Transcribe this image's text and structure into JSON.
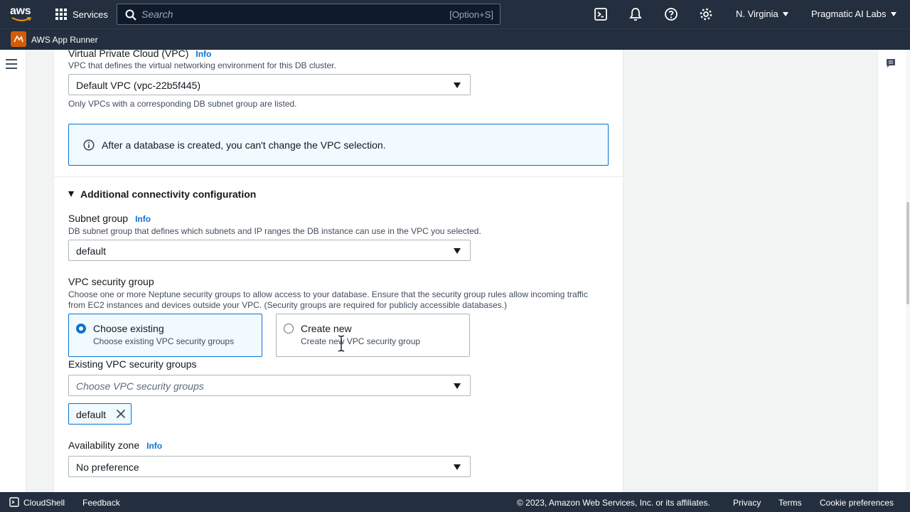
{
  "topnav": {
    "logo": "aws",
    "services": "Services",
    "search_placeholder": "Search",
    "search_shortcut": "[Option+S]",
    "region": "N. Virginia",
    "account": "Pragmatic AI Labs"
  },
  "subnav": {
    "service_name": "AWS App Runner"
  },
  "form": {
    "vpc": {
      "label": "Virtual Private Cloud (VPC)",
      "info": "Info",
      "description": "VPC that defines the virtual networking environment for this DB cluster.",
      "value": "Default VPC (vpc-22b5f445)",
      "hint": "Only VPCs with a corresponding DB subnet group are listed."
    },
    "alert": "After a database is created, you can't change the VPC selection.",
    "additional_config": "Additional connectivity configuration",
    "subnet": {
      "label": "Subnet group",
      "info": "Info",
      "description": "DB subnet group that defines which subnets and IP ranges the DB instance can use in the VPC you selected.",
      "value": "default"
    },
    "security_group": {
      "label": "VPC security group",
      "description_1": "Choose one or more Neptune security groups to allow access to your database. Ensure that the security group rules allow incoming traffic",
      "description_2": "from EC2 instances and devices outside your VPC. (Security groups are required for publicly accessible databases.)",
      "options": [
        {
          "title": "Choose existing",
          "desc": "Choose existing VPC security groups"
        },
        {
          "title": "Create new",
          "desc": "Create new VPC security group"
        }
      ]
    },
    "existing_groups": {
      "label": "Existing VPC security groups",
      "placeholder": "Choose VPC security groups",
      "token": "default"
    },
    "az": {
      "label": "Availability zone",
      "info": "Info",
      "value": "No preference"
    }
  },
  "footer": {
    "cloudshell": "CloudShell",
    "feedback": "Feedback",
    "copyright": "© 2023, Amazon Web Services, Inc. or its affiliates.",
    "privacy": "Privacy",
    "terms": "Terms",
    "cookies": "Cookie preferences"
  },
  "colors": {
    "nav": "#232f3e",
    "accent": "#0972d3",
    "service": "#d45b07"
  }
}
